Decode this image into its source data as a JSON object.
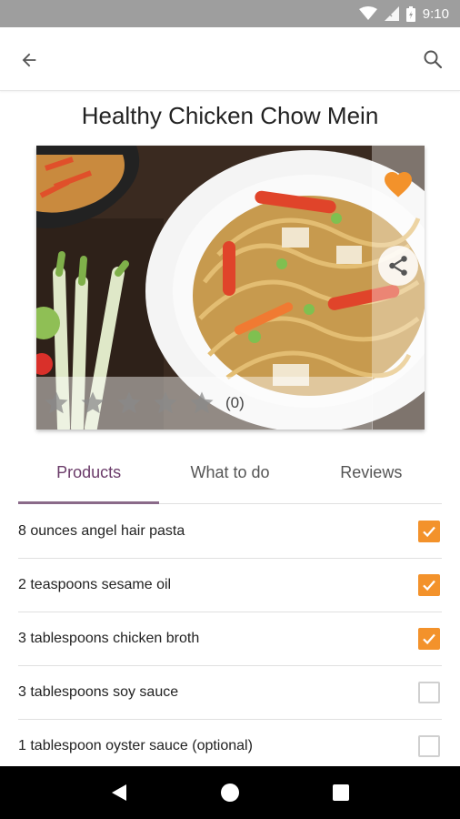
{
  "status_bar": {
    "time": "9:10"
  },
  "recipe": {
    "title": "Healthy Chicken Chow Mein"
  },
  "rating": {
    "stars_filled": 0,
    "stars_total": 5,
    "count_text": "(0)"
  },
  "tabs": [
    {
      "label": "Products",
      "active": true
    },
    {
      "label": "What to do",
      "active": false
    },
    {
      "label": "Reviews",
      "active": false
    }
  ],
  "ingredients": [
    {
      "label": "8 ounces angel hair pasta",
      "checked": true
    },
    {
      "label": "2 teaspoons sesame oil",
      "checked": true
    },
    {
      "label": "3 tablespoons chicken broth",
      "checked": true
    },
    {
      "label": "3 tablespoons soy sauce",
      "checked": false
    },
    {
      "label": "1 tablespoon oyster sauce (optional)",
      "checked": false
    }
  ],
  "icons": {
    "back": "arrow-back-icon",
    "search": "search-icon",
    "favorite": "heart-icon",
    "share": "share-icon",
    "star": "star-icon",
    "checkbox": "checkmark-icon",
    "nav_back": "triangle-back-icon",
    "nav_home": "circle-home-icon",
    "nav_recents": "square-recents-icon"
  },
  "colors": {
    "accent": "#f3922b",
    "tab_active": "#6b3c6a"
  }
}
